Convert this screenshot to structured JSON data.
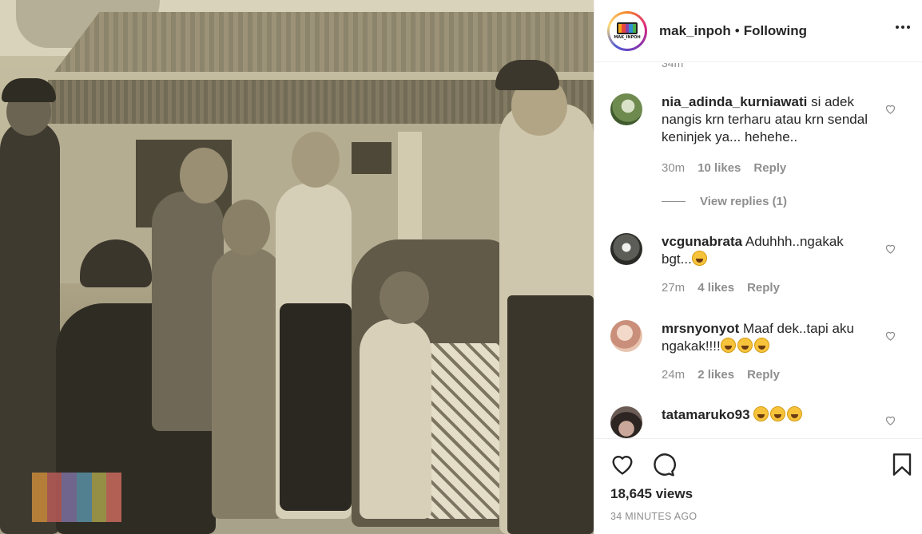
{
  "post": {
    "username": "mak_inpoh",
    "separator": "•",
    "follow_status": "Following",
    "logo_text": "MAK_INPOH",
    "views": "18,645 views",
    "time_ago": "34 MINUTES AGO"
  },
  "comments": {
    "previous_time": "34m",
    "items": [
      {
        "username": "nia_adinda_kurniawati",
        "text": "si adek nangis krn terharu atau krn sendal keninjek ya... hehehe..",
        "time": "30m",
        "likes": "10 likes",
        "reply": "Reply",
        "view_replies": "View replies (1)"
      },
      {
        "username": "vcgunabrata",
        "text": "Aduhhh..ngakak bgt...",
        "time": "27m",
        "likes": "4 likes",
        "reply": "Reply"
      },
      {
        "username": "mrsnyonyot",
        "text": "Maaf dek..tapi aku ngakak!!!!",
        "time": "24m",
        "likes": "2 likes",
        "reply": "Reply"
      },
      {
        "username": "tatamaruko93",
        "text": ""
      }
    ]
  },
  "icons": {
    "more": "more-options-icon",
    "heart": "heart-icon",
    "comment": "comment-icon",
    "bookmark": "bookmark-icon"
  },
  "colors": {
    "text": "#262626",
    "secondary": "#8e8e8e",
    "border": "#efefef"
  }
}
